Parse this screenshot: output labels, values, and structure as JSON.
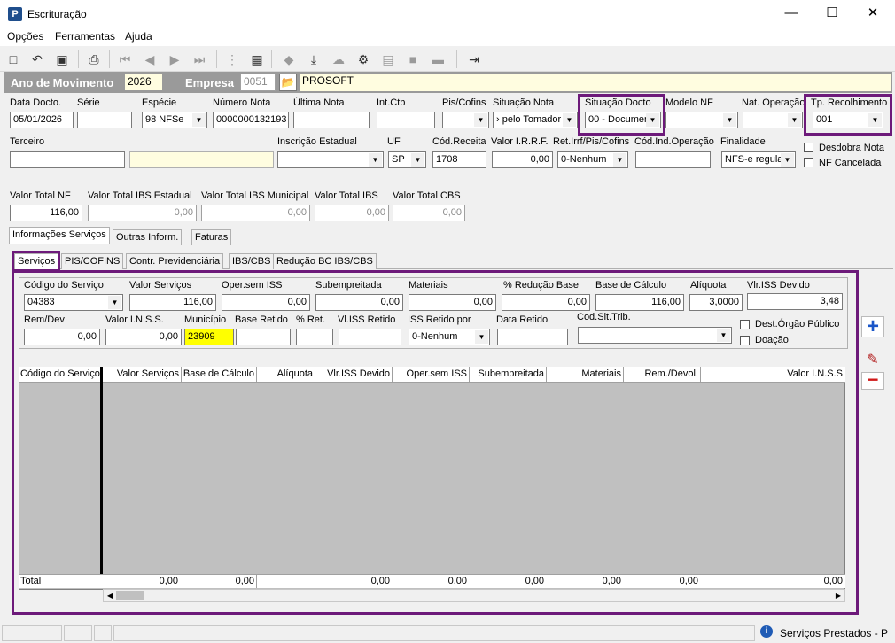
{
  "window": {
    "title": "Escrituração",
    "min": "—",
    "max": "☐",
    "close": "✕"
  },
  "menu": [
    "Opções",
    "Ferramentas",
    "Ajuda"
  ],
  "topbar": {
    "ano_label": "Ano de Movimento",
    "ano_value": "2026",
    "empresa_label": "Empresa",
    "empresa_code": "0051",
    "empresa_name": "PROSOFT"
  },
  "row1": {
    "data_docto": {
      "label": "Data Docto.",
      "value": "05/01/2026"
    },
    "serie": {
      "label": "Série",
      "value": ""
    },
    "especie": {
      "label": "Espécie",
      "value": "98 NFSe"
    },
    "numero_nota": {
      "label": "Número Nota",
      "value": "0000000132193"
    },
    "ultima_nota": {
      "label": "Última Nota",
      "value": ""
    },
    "int_ctb": {
      "label": "Int.Ctb",
      "value": ""
    },
    "pis_cofins": {
      "label": "Pis/Cofins",
      "value": ""
    },
    "situacao_nota": {
      "label": "Situação Nota",
      "value": "› pelo Tomador"
    },
    "situacao_docto": {
      "label": "Situação Docto",
      "value": "00 - Documen"
    },
    "modelo_nf": {
      "label": "Modelo NF",
      "value": ""
    },
    "nat_operacao": {
      "label": "Nat. Operação",
      "value": ""
    },
    "tp_recolhimento": {
      "label": "Tp. Recolhimento",
      "value": "001"
    }
  },
  "row2": {
    "terceiro": {
      "label": "Terceiro",
      "value": ""
    },
    "inscricao_estadual": {
      "label": "Inscrição Estadual",
      "value": ""
    },
    "uf": {
      "label": "UF",
      "value": "SP"
    },
    "cod_receita": {
      "label": "Cód.Receita",
      "value": "1708"
    },
    "valor_irrf": {
      "label": "Valor I.R.R.F.",
      "value": "0,00"
    },
    "ret_irrf": {
      "label": "Ret.Irrf/Pis/Cofins",
      "value": "0-Nenhum"
    },
    "cod_ind_operacao": {
      "label": "Cód.Ind.Operação",
      "value": ""
    },
    "finalidade": {
      "label": "Finalidade",
      "value": "NFS-e regula"
    },
    "desdobra_nota": "Desdobra Nota",
    "nf_cancelada": "NF Cancelada"
  },
  "totais": {
    "valor_total_nf": {
      "label": "Valor Total NF",
      "value": "116,00"
    },
    "ibs_estadual": {
      "label": "Valor Total IBS Estadual",
      "value": "0,00"
    },
    "ibs_municipal": {
      "label": "Valor Total IBS Municipal",
      "value": "0,00"
    },
    "ibs": {
      "label": "Valor Total IBS",
      "value": "0,00"
    },
    "cbs": {
      "label": "Valor Total CBS",
      "value": "0,00"
    }
  },
  "tabs_main": [
    "Informações Serviços",
    "Outras Inform.",
    "Faturas"
  ],
  "tabs_sub": [
    "Serviços",
    "PIS/COFINS",
    "Contr. Previdenciária",
    "IBS/CBS",
    "Redução BC IBS/CBS"
  ],
  "servico": {
    "codigo_servico": {
      "label": "Código do Serviço",
      "value": "04383"
    },
    "valor_servicos": {
      "label": "Valor Serviços",
      "value": "116,00"
    },
    "oper_sem_iss": {
      "label": "Oper.sem ISS",
      "value": "0,00"
    },
    "subempreitada": {
      "label": "Subempreitada",
      "value": "0,00"
    },
    "materiais": {
      "label": "Materiais",
      "value": "0,00"
    },
    "reducao_base": {
      "label": "% Redução Base",
      "value": "0,00"
    },
    "base_calculo": {
      "label": "Base de Cálculo",
      "value": "116,00"
    },
    "aliquota": {
      "label": "Alíquota",
      "value": "3,0000"
    },
    "vlr_iss_devido": {
      "label": "Vlr.ISS Devido",
      "value": "3,48"
    },
    "rem_dev": {
      "label": "Rem/Dev",
      "value": "0,00"
    },
    "valor_inss": {
      "label": "Valor I.N.S.S.",
      "value": "0,00"
    },
    "municipio": {
      "label": "Município",
      "value": "23909"
    },
    "base_retido": {
      "label": "Base Retido",
      "value": ""
    },
    "pct_ret": {
      "label": "% Ret.",
      "value": ""
    },
    "vl_iss_retido": {
      "label": "Vl.ISS Retido",
      "value": ""
    },
    "iss_retido_por": {
      "label": "ISS Retido por",
      "value": "0-Nenhum"
    },
    "data_retido": {
      "label": "Data Retido",
      "value": ""
    },
    "cod_sit_trib": {
      "label": "Cod.Sit.Trib.",
      "value": ""
    },
    "dest_orgao_publico": "Dest.Órgão Público",
    "doacao": "Doação"
  },
  "grid": {
    "headers": [
      "Código do Serviço",
      "Valor Serviços",
      "Base de Cálculo",
      "Alíquota",
      "Vlr.ISS Devido",
      "Oper.sem ISS",
      "Subempreitada",
      "Materiais",
      "Rem./Devol.",
      "Valor I.N.S.S"
    ],
    "total_label": "Total",
    "totals": [
      "0,00",
      "0,00",
      "0,00",
      "0,00",
      "0,00",
      "0,00",
      "0,00",
      "0,00"
    ]
  },
  "side_buttons": {
    "add": "+",
    "edit": "✎",
    "remove": "−"
  },
  "status": {
    "text": "Serviços Prestados - P"
  }
}
